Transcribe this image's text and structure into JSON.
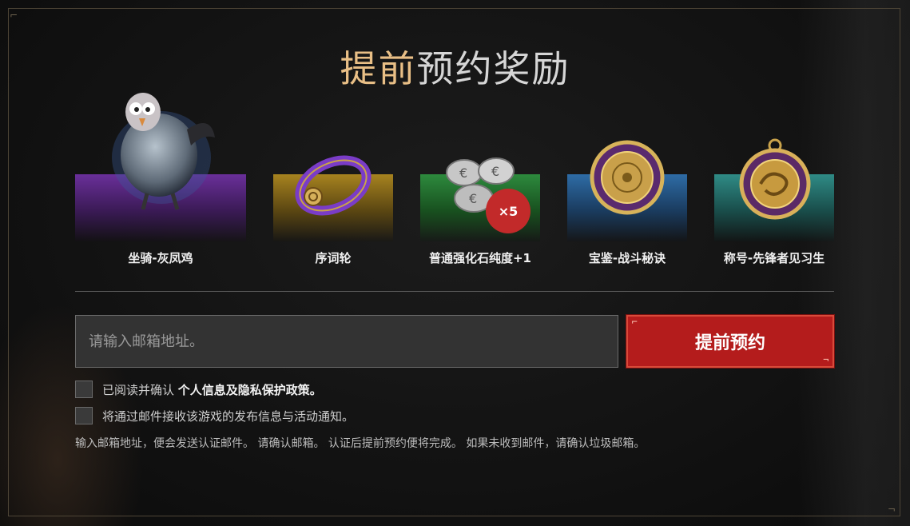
{
  "title": {
    "gold": "提前",
    "white": "预约奖励"
  },
  "rewards": [
    {
      "label": "坐骑-灰凤鸡",
      "panel_color": "#6a2f9a",
      "icon": "grey-phoenix-chicken-mount-icon"
    },
    {
      "label": "序词轮",
      "panel_color": "#a7831f",
      "icon": "purple-ring-icon"
    },
    {
      "label": "普通强化石纯度+1",
      "panel_color": "#2d8a3d",
      "icon": "silver-stones-icon",
      "badge": "×5"
    },
    {
      "label": "宝鉴-战斗秘诀",
      "panel_color": "#2e6ca6",
      "icon": "golden-medallion-icon"
    },
    {
      "label": "称号-先锋者见习生",
      "panel_color": "#2f8b86",
      "icon": "dragon-emblem-icon"
    }
  ],
  "form": {
    "email_placeholder": "请输入邮箱地址。",
    "reserve_button": "提前预约",
    "agree_privacy": {
      "prefix": "已阅读并确认",
      "link": "个人信息及隐私保护政策。"
    },
    "agree_mail": "将通过邮件接收该游戏的发布信息与活动通知。",
    "note": "输入邮箱地址，便会发送认证邮件。 请确认邮箱。 认证后提前预约便将完成。 如果未收到邮件，请确认垃圾邮箱。"
  },
  "colors": {
    "accent_gold": "#e9bf86",
    "button_red": "#b41c1c"
  }
}
